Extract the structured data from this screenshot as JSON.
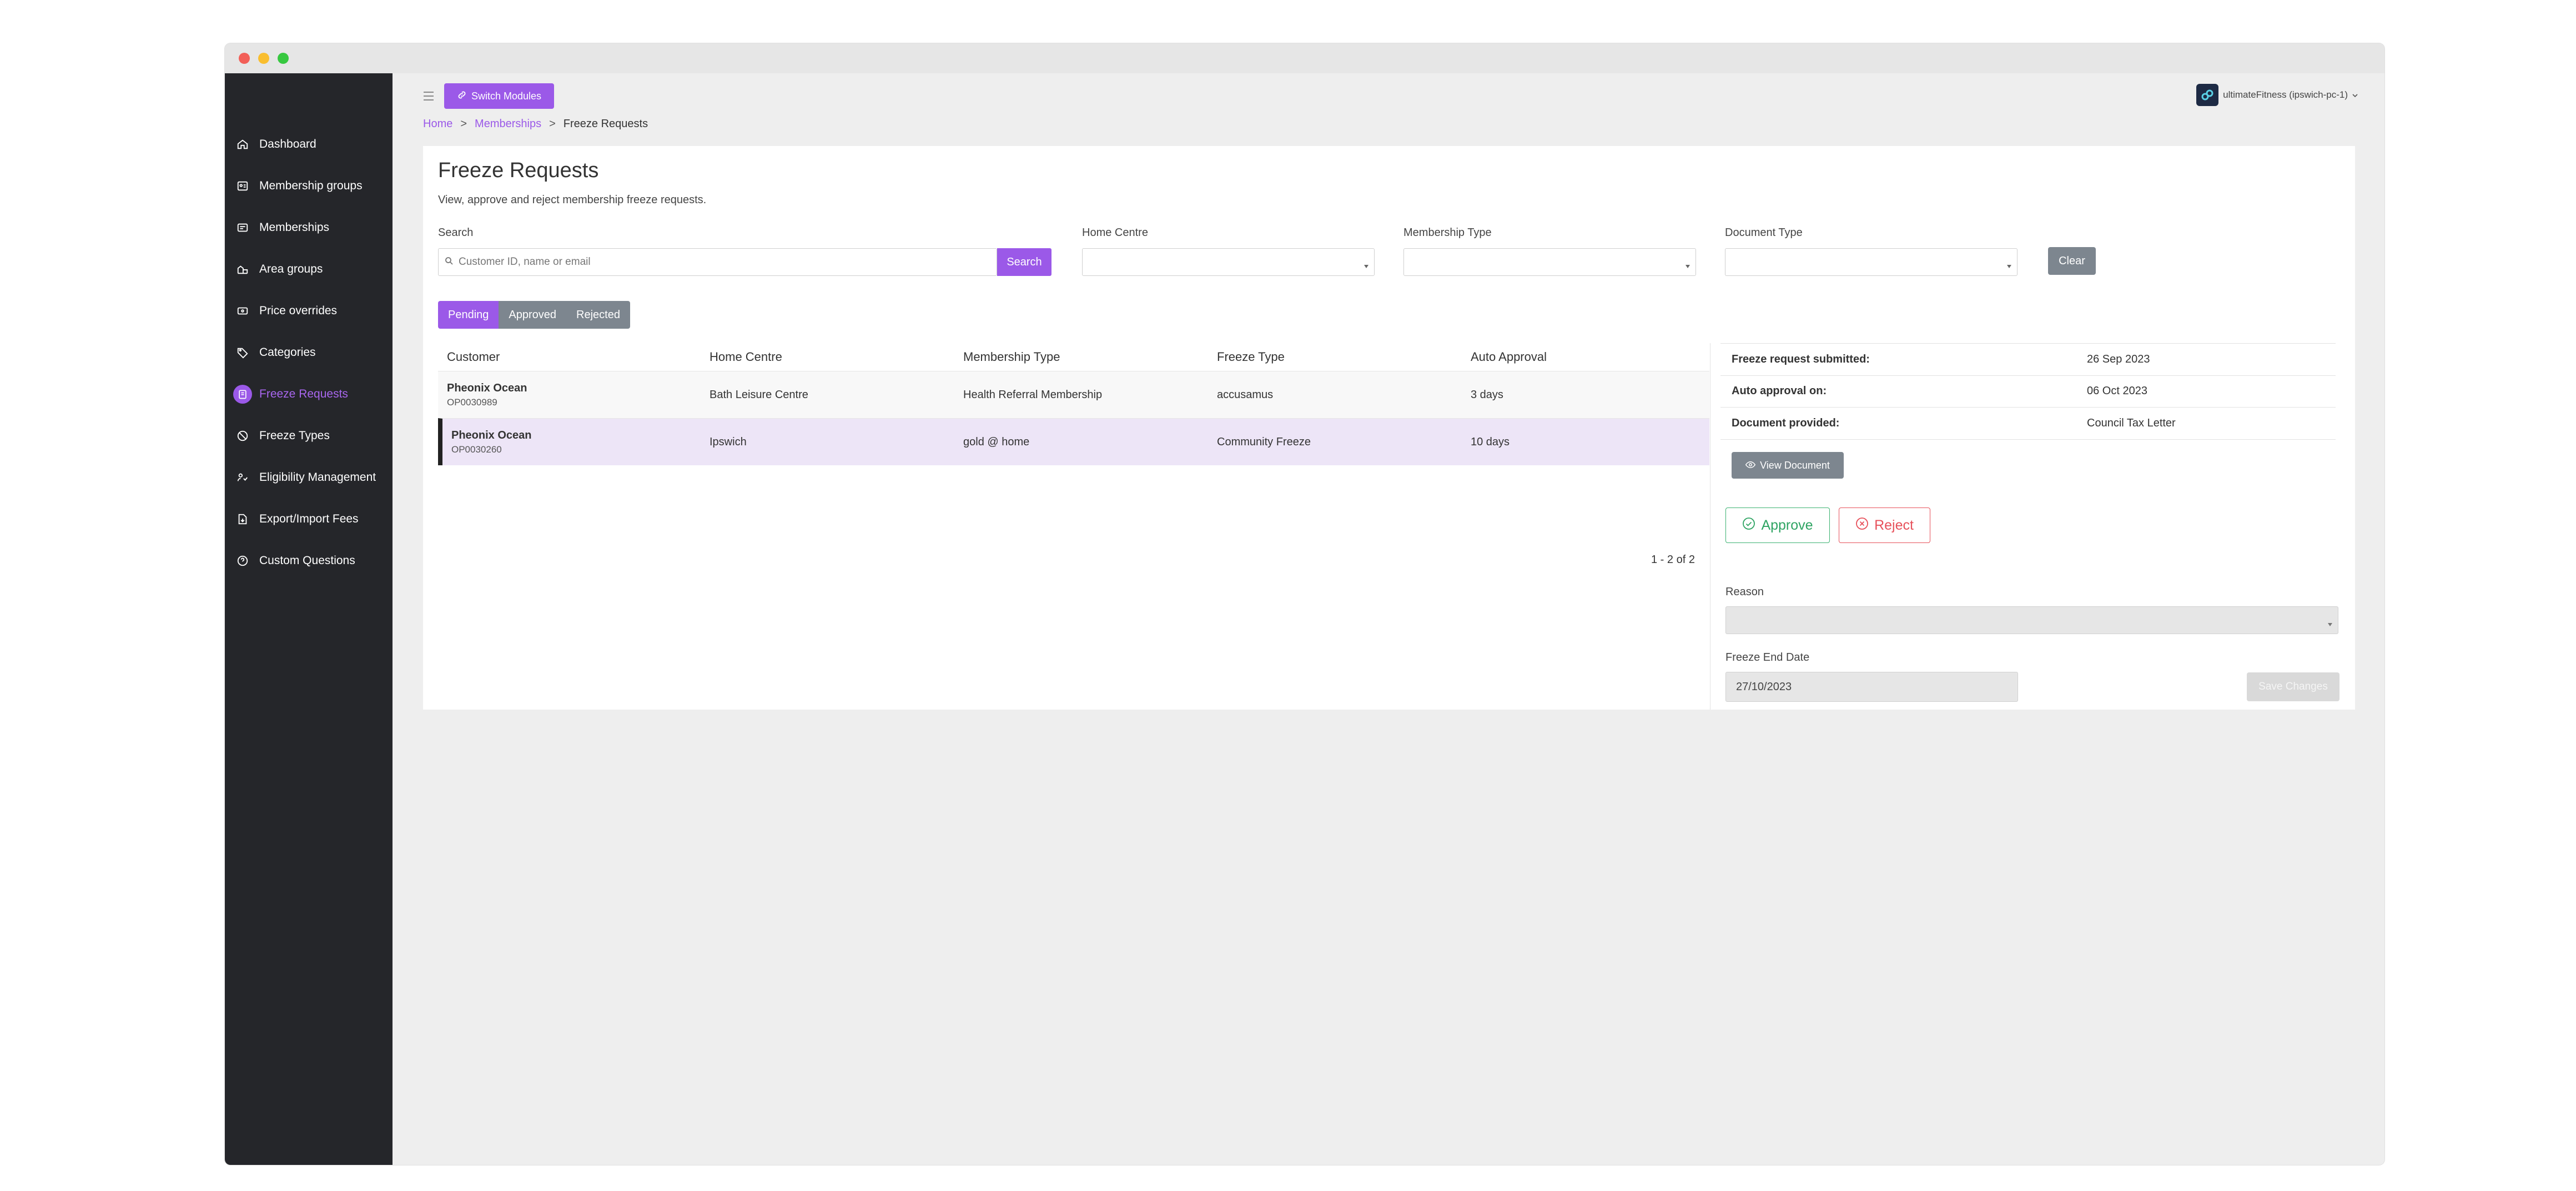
{
  "window": {
    "traffic_lights": [
      "close",
      "minimize",
      "maximize"
    ]
  },
  "sidebar": {
    "items": [
      {
        "label": "Dashboard",
        "icon": "home-icon",
        "active": false
      },
      {
        "label": "Membership groups",
        "icon": "membership-groups-icon",
        "active": false
      },
      {
        "label": "Memberships",
        "icon": "memberships-icon",
        "active": false
      },
      {
        "label": "Area groups",
        "icon": "area-groups-icon",
        "active": false
      },
      {
        "label": "Price overrides",
        "icon": "price-overrides-icon",
        "active": false
      },
      {
        "label": "Categories",
        "icon": "tag-icon",
        "active": false
      },
      {
        "label": "Freeze Requests",
        "icon": "freeze-requests-icon",
        "active": true
      },
      {
        "label": "Freeze Types",
        "icon": "freeze-types-icon",
        "active": false
      },
      {
        "label": "Eligibility Management",
        "icon": "eligibility-icon",
        "active": false
      },
      {
        "label": "Export/Import Fees",
        "icon": "export-import-icon",
        "active": false
      },
      {
        "label": "Custom Questions",
        "icon": "question-icon",
        "active": false
      }
    ]
  },
  "topbar": {
    "switch_modules_label": "Switch Modules",
    "user_label": "ultimateFitness (ipswich-pc-1)"
  },
  "breadcrumb": {
    "home": "Home",
    "memberships": "Memberships",
    "current": "Freeze Requests",
    "separator": ">"
  },
  "page": {
    "title": "Freeze Requests",
    "subtitle": "View, approve and reject membership freeze requests."
  },
  "filters": {
    "search_label": "Search",
    "search_placeholder": "Customer ID, name or email",
    "search_value": "",
    "search_button": "Search",
    "home_centre_label": "Home Centre",
    "membership_type_label": "Membership Type",
    "document_type_label": "Document Type",
    "clear_button": "Clear"
  },
  "tabs": [
    {
      "label": "Pending",
      "active": true
    },
    {
      "label": "Approved",
      "active": false
    },
    {
      "label": "Rejected",
      "active": false
    }
  ],
  "table": {
    "headers": [
      "Customer",
      "Home Centre",
      "Membership Type",
      "Freeze Type",
      "Auto Approval"
    ],
    "rows": [
      {
        "name": "Pheonix Ocean",
        "id": "OP0030989",
        "home_centre": "Bath Leisure Centre",
        "membership_type": "Health Referral Membership",
        "freeze_type": "accusamus",
        "auto_approval": "3 days",
        "selected": false
      },
      {
        "name": "Pheonix Ocean",
        "id": "OP0030260",
        "home_centre": "Ipswich",
        "membership_type": "gold @ home",
        "freeze_type": "Community Freeze",
        "auto_approval": "10 days",
        "selected": true
      }
    ],
    "pagination": "1 - 2 of 2"
  },
  "detail": {
    "submitted_label": "Freeze request submitted:",
    "submitted_value": "26 Sep 2023",
    "auto_approval_label": "Auto approval on:",
    "auto_approval_value": "06 Oct 2023",
    "document_label": "Document provided:",
    "document_value": "Council Tax Letter",
    "view_document_button": "View Document",
    "approve_button": "Approve",
    "reject_button": "Reject",
    "reason_label": "Reason",
    "reason_value": "",
    "freeze_end_label": "Freeze End Date",
    "freeze_end_value": "27/10/2023",
    "save_button": "Save Changes"
  },
  "colors": {
    "accent": "#9b59e8",
    "sidebar_bg": "#25262a",
    "approve": "#3cb371",
    "reject": "#e7505a",
    "neutral_button": "#7d868f"
  }
}
